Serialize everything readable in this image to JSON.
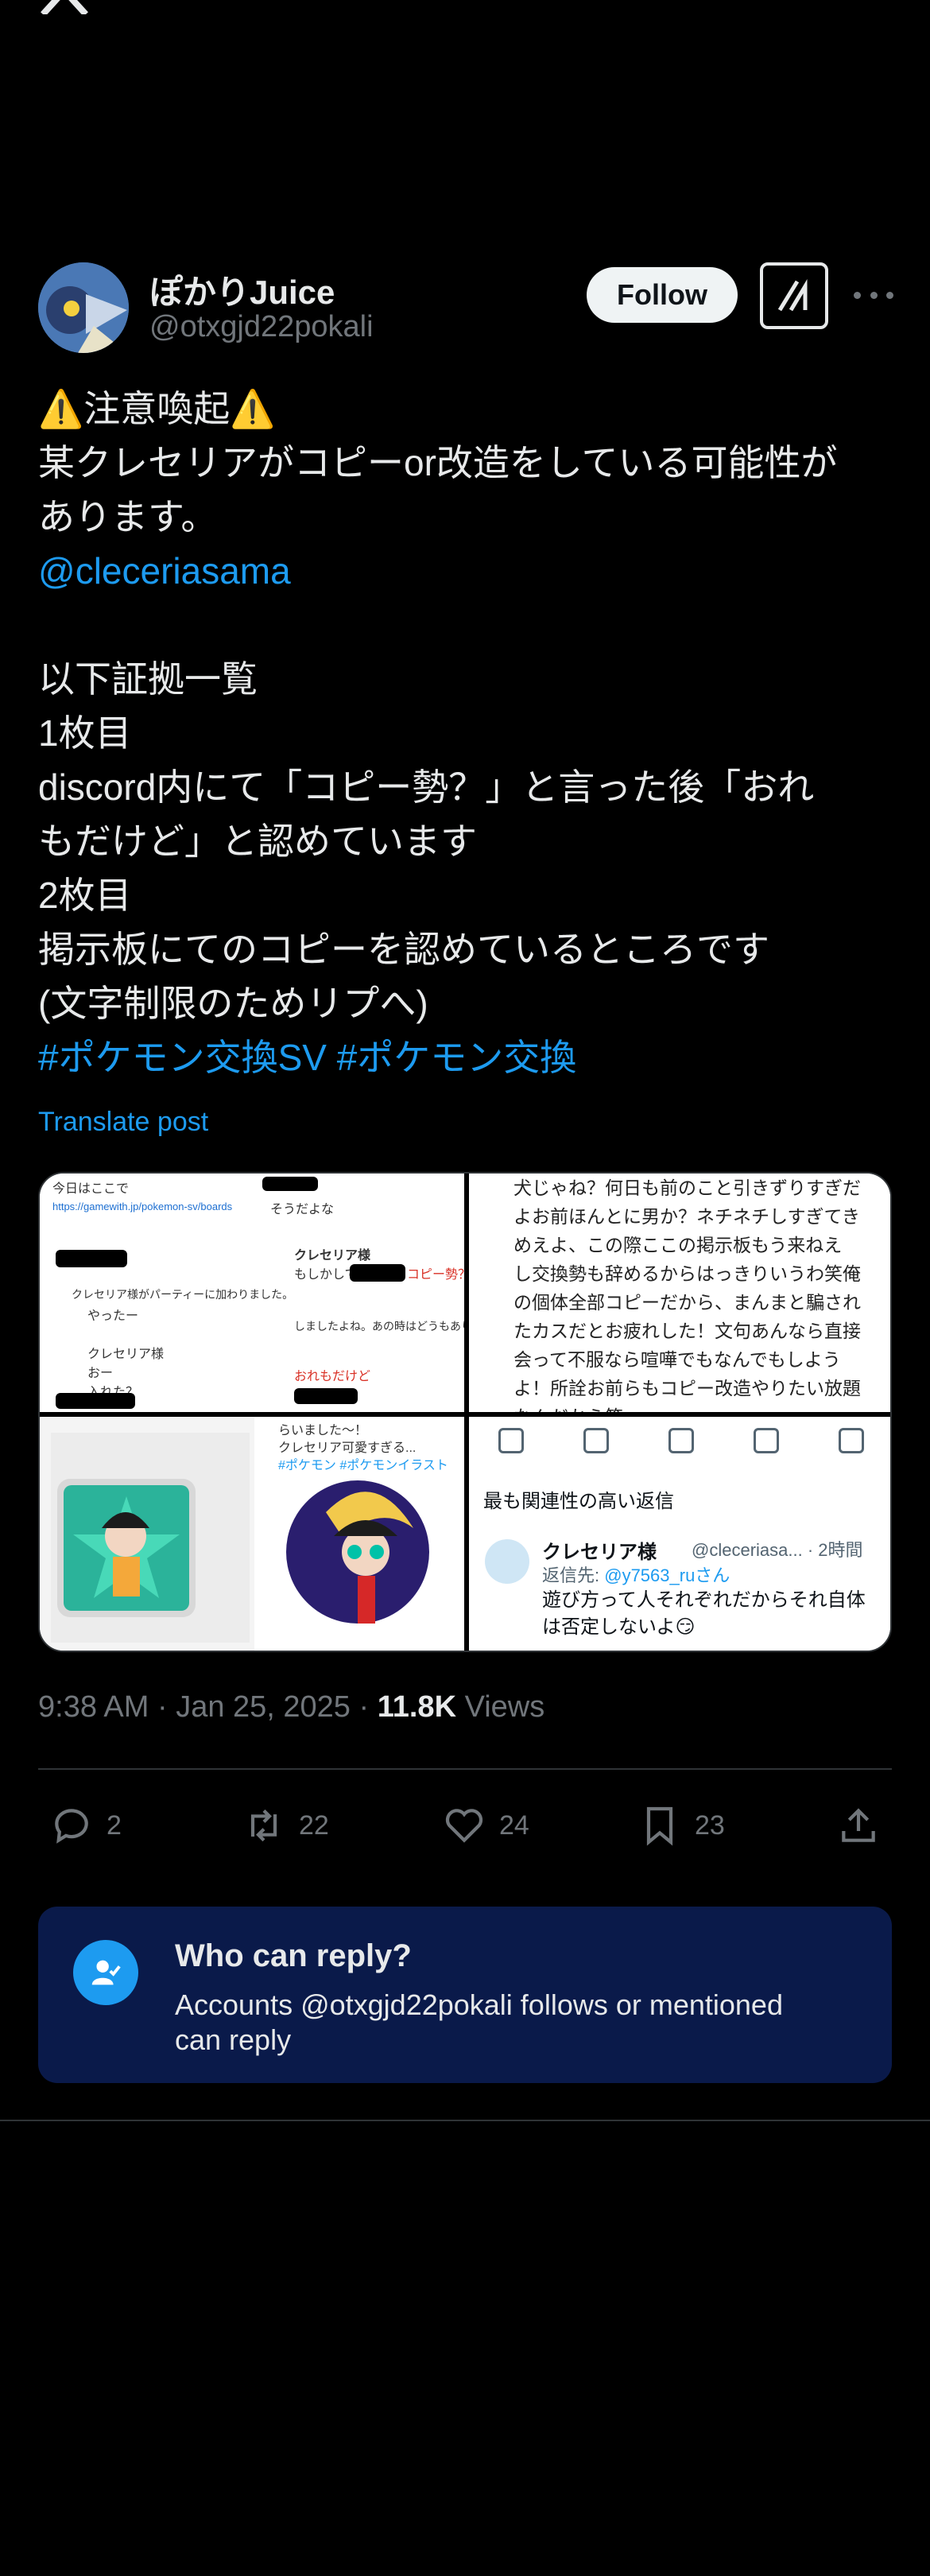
{
  "author": {
    "name": "ぽかりJuice",
    "handle": "@otxgjd22pokali",
    "follow_label": "Follow"
  },
  "post": {
    "lines": [
      "⚠️注意喚起⚠️",
      "某クレセリアがコピーor改造をしている可能性が",
      "あります。"
    ],
    "mention": "@cleceriasama",
    "evidence_lines": [
      "以下証拠一覧",
      "1枚目",
      "discord内にて「コピー勢？」と言った後「おれ",
      "もだけど」と認めています",
      "2枚目",
      "掲示板にてのコピーを認めているところです",
      "(文字制限のためリプへ)"
    ],
    "hashtags": "#ポケモン交換SV #ポケモン交換",
    "translate_label": "Translate post"
  },
  "media": {
    "img1": {
      "lines": [
        "今日はここで",
        "https://gamewith.jp/pokemon-sv/boards",
        "クレセリア様がパーティーに加わりました。",
        "やったー",
        "クレセリア様",
        "おー",
        "入れた？",
        "クレセリア様",
        "そうだよな",
        "もしかして",
        "コピー勢？",
        "しましたよね。あの時はどうもありがとうございます",
        "おれもだけど"
      ]
    },
    "img2": {
      "lines": [
        "犬じゃね？何日も前のこと引きずりすぎだ",
        "よお前ほんとに男か？ネチネチしすぎてき",
        "めえよ、この際ここの掲示板もう来ねえ",
        "し交換勢も辞めるからはっきりいうわ笑俺",
        "の個体全部コピーだから、まんまと騙され",
        "たカスだとお疲れした！文句あんなら直接",
        "会って不服なら喧嘩でもなんでもしよう",
        "よ！所詮お前らもコピー改造やりたい放題",
        "なんだから笑"
      ]
    },
    "img3": {
      "lines": [
        "らいました〜！",
        "クレセリア可愛すぎる...",
        "#ポケモン #ポケモンイラスト"
      ]
    },
    "img4": {
      "sort_label": "最も関連性の高い返信",
      "reply_name": "クレセリア様",
      "reply_handle": "@cleceriasa... · 2時間",
      "reply_to_prefix": "返信先: ",
      "reply_to_handle": "@y7563_ruさん",
      "reply_body": "遊び方って人それぞれだからそれ自体は否定しないよ😏"
    }
  },
  "meta": {
    "time": "9:38 AM · Jan 25, 2025 · ",
    "views_count": "11.8K",
    "views_label": " Views"
  },
  "actions": {
    "replies": "2",
    "reposts": "22",
    "likes": "24",
    "bookmarks": "23"
  },
  "reply_restriction": {
    "title": "Who can reply?",
    "description": "Accounts @otxgjd22pokali follows or mentioned can reply"
  }
}
